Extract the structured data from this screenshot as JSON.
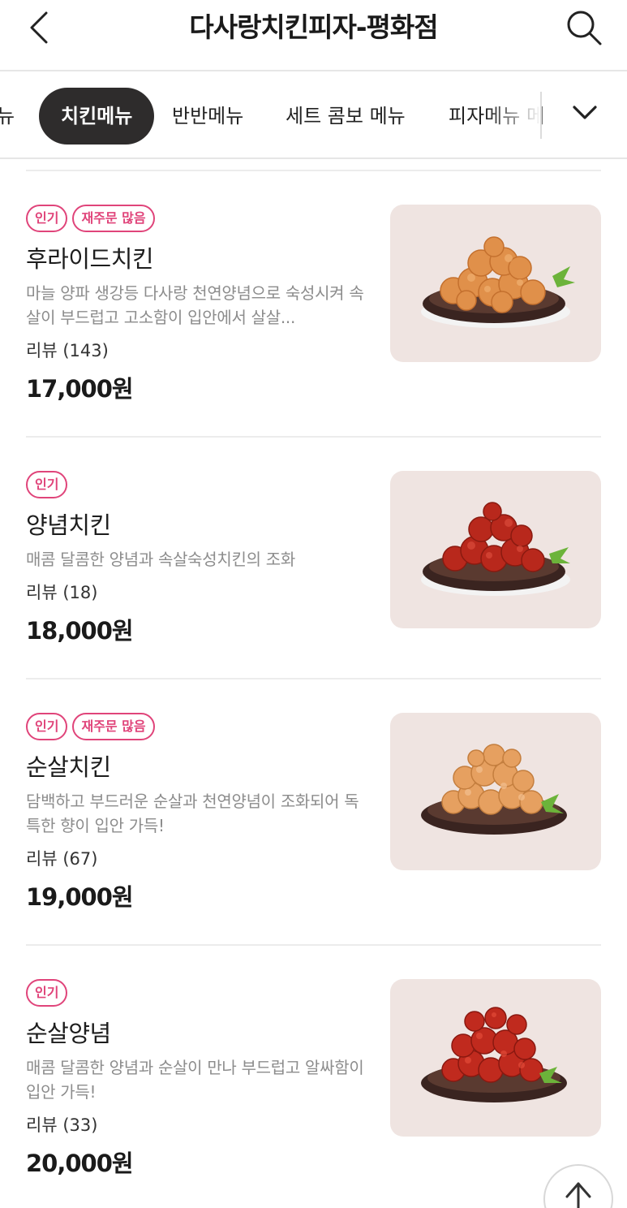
{
  "header": {
    "title": "다사랑치킨피자-평화점"
  },
  "tabs": {
    "items": [
      {
        "label": "뉴"
      },
      {
        "label": "치킨메뉴",
        "active": true
      },
      {
        "label": "반반메뉴"
      },
      {
        "label": "세트 콤보 메뉴"
      },
      {
        "label": "피자메뉴 메"
      }
    ]
  },
  "menu": {
    "items": [
      {
        "badges": [
          "인기",
          "재주문 많음"
        ],
        "name": "후라이드치킨",
        "description": "마늘 양파 생강등 다사랑 천연양념으로 숙성시켜 속살이 부드럽고 고소함이 입안에서 살살...",
        "review": "리뷰 (143)",
        "price": "17,000원"
      },
      {
        "badges": [
          "인기"
        ],
        "name": "양념치킨",
        "description": "매콤 달콤한 양념과 속살숙성치킨의 조화",
        "review": "리뷰 (18)",
        "price": "18,000원"
      },
      {
        "badges": [
          "인기",
          "재주문 많음"
        ],
        "name": "순살치킨",
        "description": "담백하고 부드러운 순살과 천연양념이 조화되어 독특한 향이 입안 가득!",
        "review": "리뷰 (67)",
        "price": "19,000원"
      },
      {
        "badges": [
          "인기"
        ],
        "name": "순살양념",
        "description": "매콤 달콤한 양념과 순살이 만나 부드럽고 알싸함이 입안 가득!",
        "review": "리뷰 (33)",
        "price": "20,000원"
      }
    ]
  },
  "colors": {
    "accent_pink": "#e0447a",
    "active_tab": "#2e2c2c",
    "thumb_bg": "#efe4e1",
    "fried_chicken": "#e0904a",
    "sauced_chicken": "#b8281c"
  },
  "icons": {
    "back": "chevron-left-icon",
    "search": "search-icon",
    "more_tabs": "chevron-down-icon",
    "scroll_top": "arrow-up-icon"
  }
}
